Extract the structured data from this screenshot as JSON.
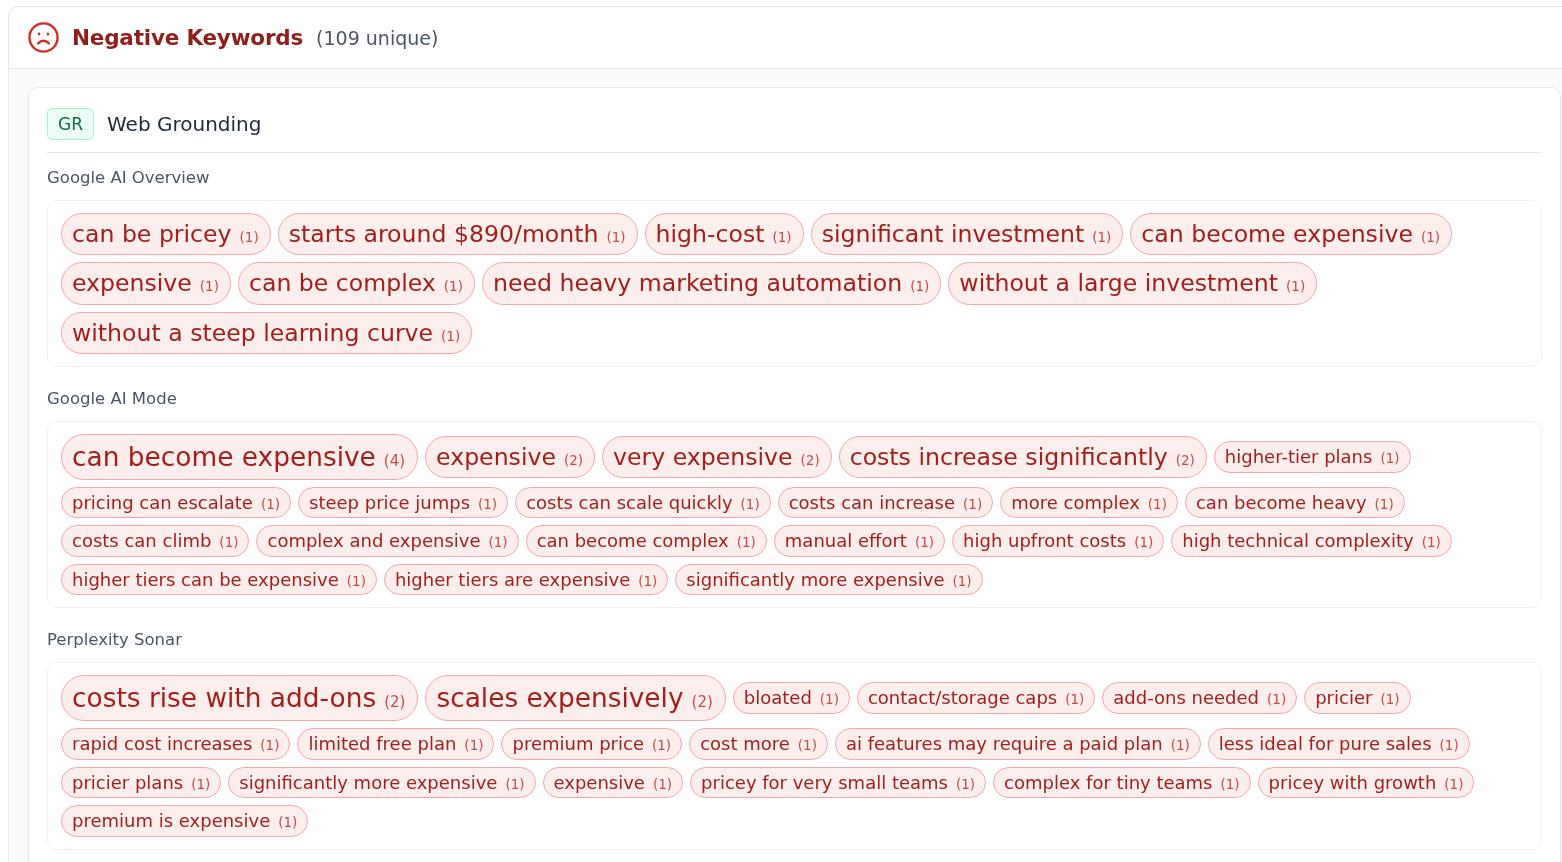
{
  "header": {
    "title": "Negative Keywords",
    "count": "(109 unique)"
  },
  "group": {
    "badge": "GR",
    "title": "Web Grounding",
    "sections": [
      {
        "label": "Google AI Overview",
        "keywords": [
          {
            "text": "can be pricey",
            "count": "(1)",
            "kind": "large"
          },
          {
            "text": "starts around $890/month",
            "count": "(1)",
            "kind": "large"
          },
          {
            "text": "high-cost",
            "count": "(1)",
            "kind": "large"
          },
          {
            "text": "significant investment",
            "count": "(1)",
            "kind": "large"
          },
          {
            "text": "can become expensive",
            "count": "(1)",
            "kind": "large"
          },
          {
            "text": "expensive",
            "count": "(1)",
            "kind": "large"
          },
          {
            "text": "can be complex",
            "count": "(1)",
            "kind": "large"
          },
          {
            "text": "need heavy marketing automation",
            "count": "(1)",
            "kind": "large"
          },
          {
            "text": "without a large investment",
            "count": "(1)",
            "kind": "large"
          },
          {
            "text": "without a steep learning curve",
            "count": "(1)",
            "kind": "large"
          }
        ]
      },
      {
        "label": "Google AI Mode",
        "keywords": [
          {
            "text": "can become expensive",
            "count": "(4)",
            "kind": "xlarge"
          },
          {
            "text": "expensive",
            "count": "(2)",
            "kind": "large"
          },
          {
            "text": "very expensive",
            "count": "(2)",
            "kind": "large"
          },
          {
            "text": "costs increase significantly",
            "count": "(2)",
            "kind": "large"
          },
          {
            "text": "higher-tier plans",
            "count": "(1)",
            "kind": "small"
          },
          {
            "text": "pricing can escalate",
            "count": "(1)",
            "kind": "small"
          },
          {
            "text": "steep price jumps",
            "count": "(1)",
            "kind": "small"
          },
          {
            "text": "costs can scale quickly",
            "count": "(1)",
            "kind": "small"
          },
          {
            "text": "costs can increase",
            "count": "(1)",
            "kind": "small"
          },
          {
            "text": "more complex",
            "count": "(1)",
            "kind": "small"
          },
          {
            "text": "can become heavy",
            "count": "(1)",
            "kind": "small"
          },
          {
            "text": "costs can climb",
            "count": "(1)",
            "kind": "small"
          },
          {
            "text": "complex and expensive",
            "count": "(1)",
            "kind": "small"
          },
          {
            "text": "can become complex",
            "count": "(1)",
            "kind": "small"
          },
          {
            "text": "manual effort",
            "count": "(1)",
            "kind": "small"
          },
          {
            "text": "high upfront costs",
            "count": "(1)",
            "kind": "small"
          },
          {
            "text": "high technical complexity",
            "count": "(1)",
            "kind": "small"
          },
          {
            "text": "higher tiers can be expensive",
            "count": "(1)",
            "kind": "small"
          },
          {
            "text": "higher tiers are expensive",
            "count": "(1)",
            "kind": "small"
          },
          {
            "text": "significantly more expensive",
            "count": "(1)",
            "kind": "small"
          }
        ]
      },
      {
        "label": "Perplexity Sonar",
        "keywords": [
          {
            "text": "costs rise with add-ons",
            "count": "(2)",
            "kind": "xlarge"
          },
          {
            "text": "scales expensively",
            "count": "(2)",
            "kind": "xlarge"
          },
          {
            "text": "bloated",
            "count": "(1)",
            "kind": "small"
          },
          {
            "text": "contact/storage caps",
            "count": "(1)",
            "kind": "small"
          },
          {
            "text": "add-ons needed",
            "count": "(1)",
            "kind": "small"
          },
          {
            "text": "pricier",
            "count": "(1)",
            "kind": "small"
          },
          {
            "text": "rapid cost increases",
            "count": "(1)",
            "kind": "small"
          },
          {
            "text": "limited free plan",
            "count": "(1)",
            "kind": "small"
          },
          {
            "text": "premium price",
            "count": "(1)",
            "kind": "small"
          },
          {
            "text": "cost more",
            "count": "(1)",
            "kind": "small"
          },
          {
            "text": "ai features may require a paid plan",
            "count": "(1)",
            "kind": "small"
          },
          {
            "text": "less ideal for pure sales",
            "count": "(1)",
            "kind": "small"
          },
          {
            "text": "pricier plans",
            "count": "(1)",
            "kind": "small"
          },
          {
            "text": "significantly more expensive",
            "count": "(1)",
            "kind": "small"
          },
          {
            "text": "expensive",
            "count": "(1)",
            "kind": "small"
          },
          {
            "text": "pricey for very small teams",
            "count": "(1)",
            "kind": "small"
          },
          {
            "text": "complex for tiny teams",
            "count": "(1)",
            "kind": "small"
          },
          {
            "text": "pricey with growth",
            "count": "(1)",
            "kind": "small"
          },
          {
            "text": "premium is expensive",
            "count": "(1)",
            "kind": "small"
          }
        ]
      }
    ]
  }
}
